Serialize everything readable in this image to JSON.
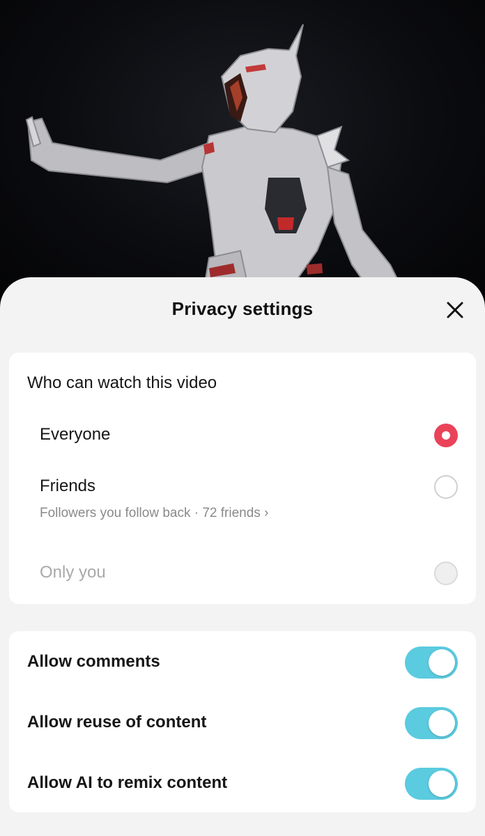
{
  "sheet": {
    "title": "Privacy settings"
  },
  "privacy": {
    "heading": "Who can watch this video",
    "options": [
      {
        "label": "Everyone",
        "state": "selected"
      },
      {
        "label": "Friends",
        "sublabel": "Followers you follow back · 72 friends ›",
        "state": "unselected"
      },
      {
        "label": "Only you",
        "state": "disabled"
      }
    ]
  },
  "toggles": [
    {
      "label": "Allow comments",
      "on": true
    },
    {
      "label": "Allow reuse of content",
      "on": true
    },
    {
      "label": "Allow AI to remix content",
      "on": true
    }
  ],
  "colors": {
    "accent_radio": "#ea4359",
    "toggle_on": "#5bcbe0",
    "sheet_bg": "#f3f3f3",
    "card_bg": "#ffffff"
  },
  "icons": {
    "close": "close-icon"
  }
}
